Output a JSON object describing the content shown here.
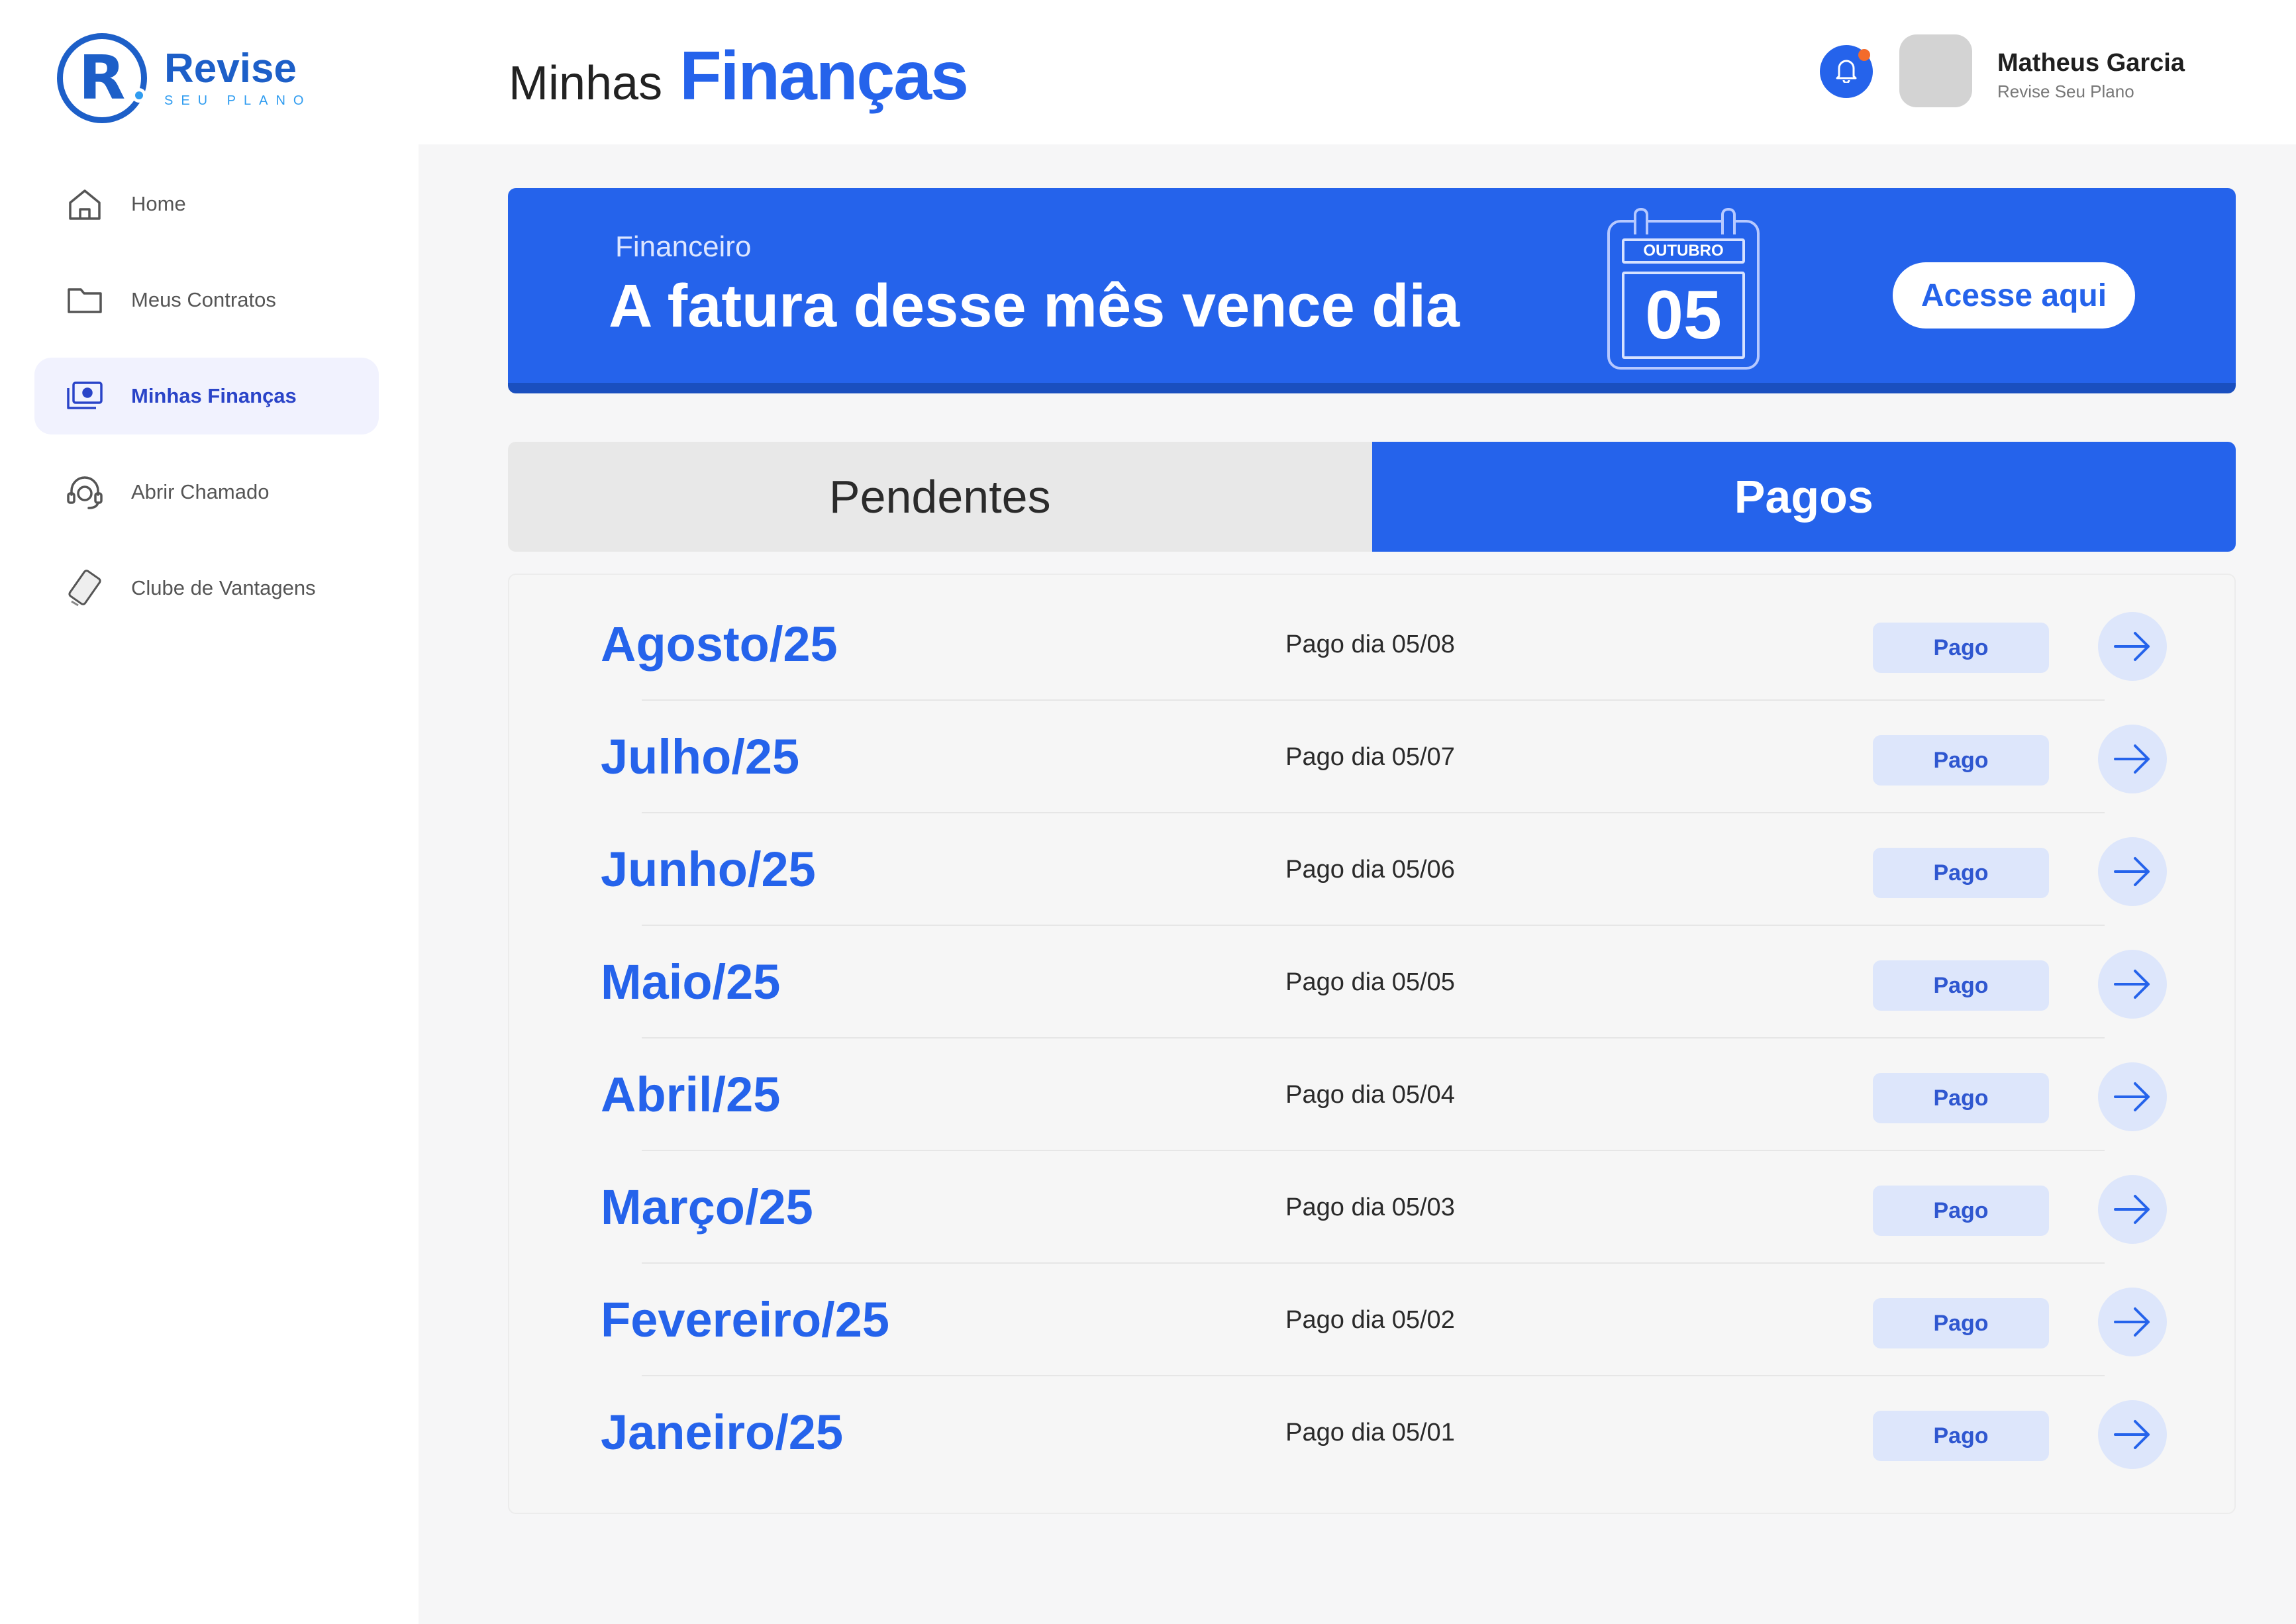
{
  "brand": {
    "name": "Revise",
    "tagline": "SEU PLANO",
    "mark_letter": "R",
    "primary_color": "#2563eb",
    "logo_color": "#1d5fc8"
  },
  "sidebar": {
    "items": [
      {
        "label": "Home",
        "icon": "home-icon"
      },
      {
        "label": "Meus Contratos",
        "icon": "folder-icon"
      },
      {
        "label": "Minhas Finanças",
        "icon": "money-icon",
        "active": true
      },
      {
        "label": "Abrir Chamado",
        "icon": "headset-icon"
      },
      {
        "label": "Clube de Vantagens",
        "icon": "card-icon"
      }
    ]
  },
  "header": {
    "title_light": "Minhas",
    "title_bold": "Finanças",
    "user_name": "Matheus Garcia",
    "user_sub": "Revise Seu Plano",
    "notification_badge_color": "#f36b2b"
  },
  "banner": {
    "category": "Financeiro",
    "headline": "A fatura desse mês vence dia",
    "calendar_month": "OUTUBRO",
    "calendar_day": "05",
    "button_label": "Acesse aqui"
  },
  "tabs": [
    {
      "label": "Pendentes",
      "active": false
    },
    {
      "label": "Pagos",
      "active": true
    }
  ],
  "payments": [
    {
      "month": "Agosto/25",
      "date": "Pago dia 05/08",
      "status": "Pago"
    },
    {
      "month": "Julho/25",
      "date": "Pago dia 05/07",
      "status": "Pago"
    },
    {
      "month": "Junho/25",
      "date": "Pago dia 05/06",
      "status": "Pago"
    },
    {
      "month": "Maio/25",
      "date": "Pago dia 05/05",
      "status": "Pago"
    },
    {
      "month": "Abril/25",
      "date": "Pago dia 05/04",
      "status": "Pago"
    },
    {
      "month": "Março/25",
      "date": "Pago dia 05/03",
      "status": "Pago"
    },
    {
      "month": "Fevereiro/25",
      "date": "Pago dia 05/02",
      "status": "Pago"
    },
    {
      "month": "Janeiro/25",
      "date": "Pago dia 05/01",
      "status": "Pago"
    }
  ]
}
